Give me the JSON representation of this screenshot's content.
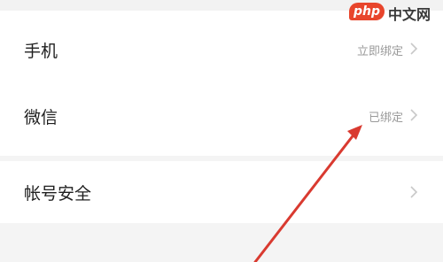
{
  "watermark": {
    "badge": "php",
    "text": "中文网"
  },
  "rows": [
    {
      "label": "手机",
      "status": "立即绑定"
    },
    {
      "label": "微信",
      "status": "已绑定"
    },
    {
      "label": "帐号安全",
      "status": ""
    }
  ],
  "colors": {
    "arrow": "#d93a30",
    "chevron": "#c8c8c8"
  }
}
